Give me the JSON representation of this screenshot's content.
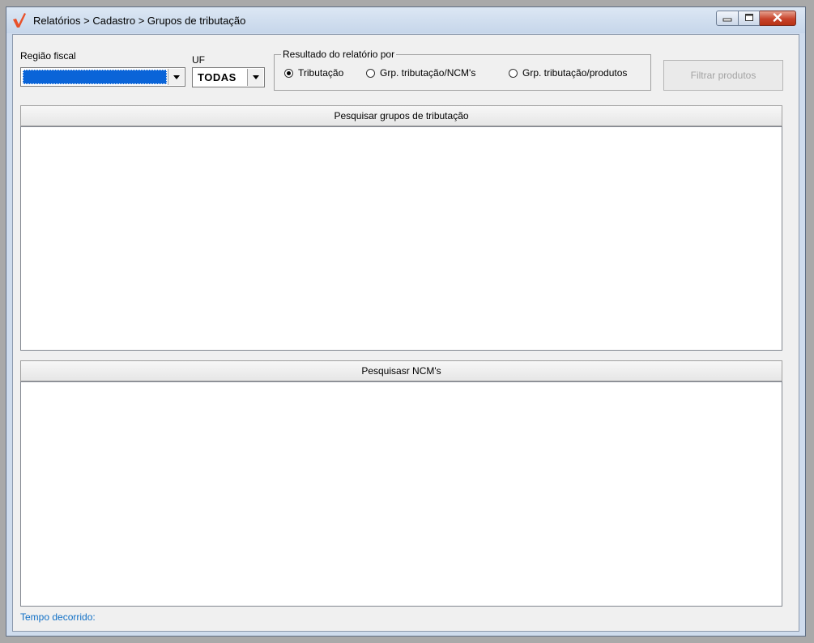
{
  "window": {
    "title": "Relatórios > Cadastro > Grupos de tributação",
    "colors": {
      "logo_accent": "#e8512a",
      "selection": "#0a64d8",
      "status_text": "#1170c6"
    },
    "controls": {
      "minimize_icon": "minimize-icon",
      "maximize_icon": "maximize-icon",
      "close_icon": "close-icon"
    }
  },
  "filters": {
    "regiao_fiscal": {
      "label": "Região fiscal",
      "value": ""
    },
    "uf": {
      "label": "UF",
      "value": "TODAS"
    }
  },
  "resultado": {
    "legend": "Resultado do relatório por",
    "options": [
      {
        "label": "Tributação",
        "checked": true
      },
      {
        "label": "Grp. tributação/NCM's",
        "checked": false
      },
      {
        "label": "Grp. tributação/produtos",
        "checked": false
      }
    ]
  },
  "actions": {
    "filtrar_produtos": "Filtrar produtos"
  },
  "panels": {
    "grupos": {
      "header": "Pesquisar grupos de tributação"
    },
    "ncms": {
      "header": "Pesquisasr NCM's"
    }
  },
  "status": {
    "tempo_decorrido": "Tempo decorrido:"
  }
}
